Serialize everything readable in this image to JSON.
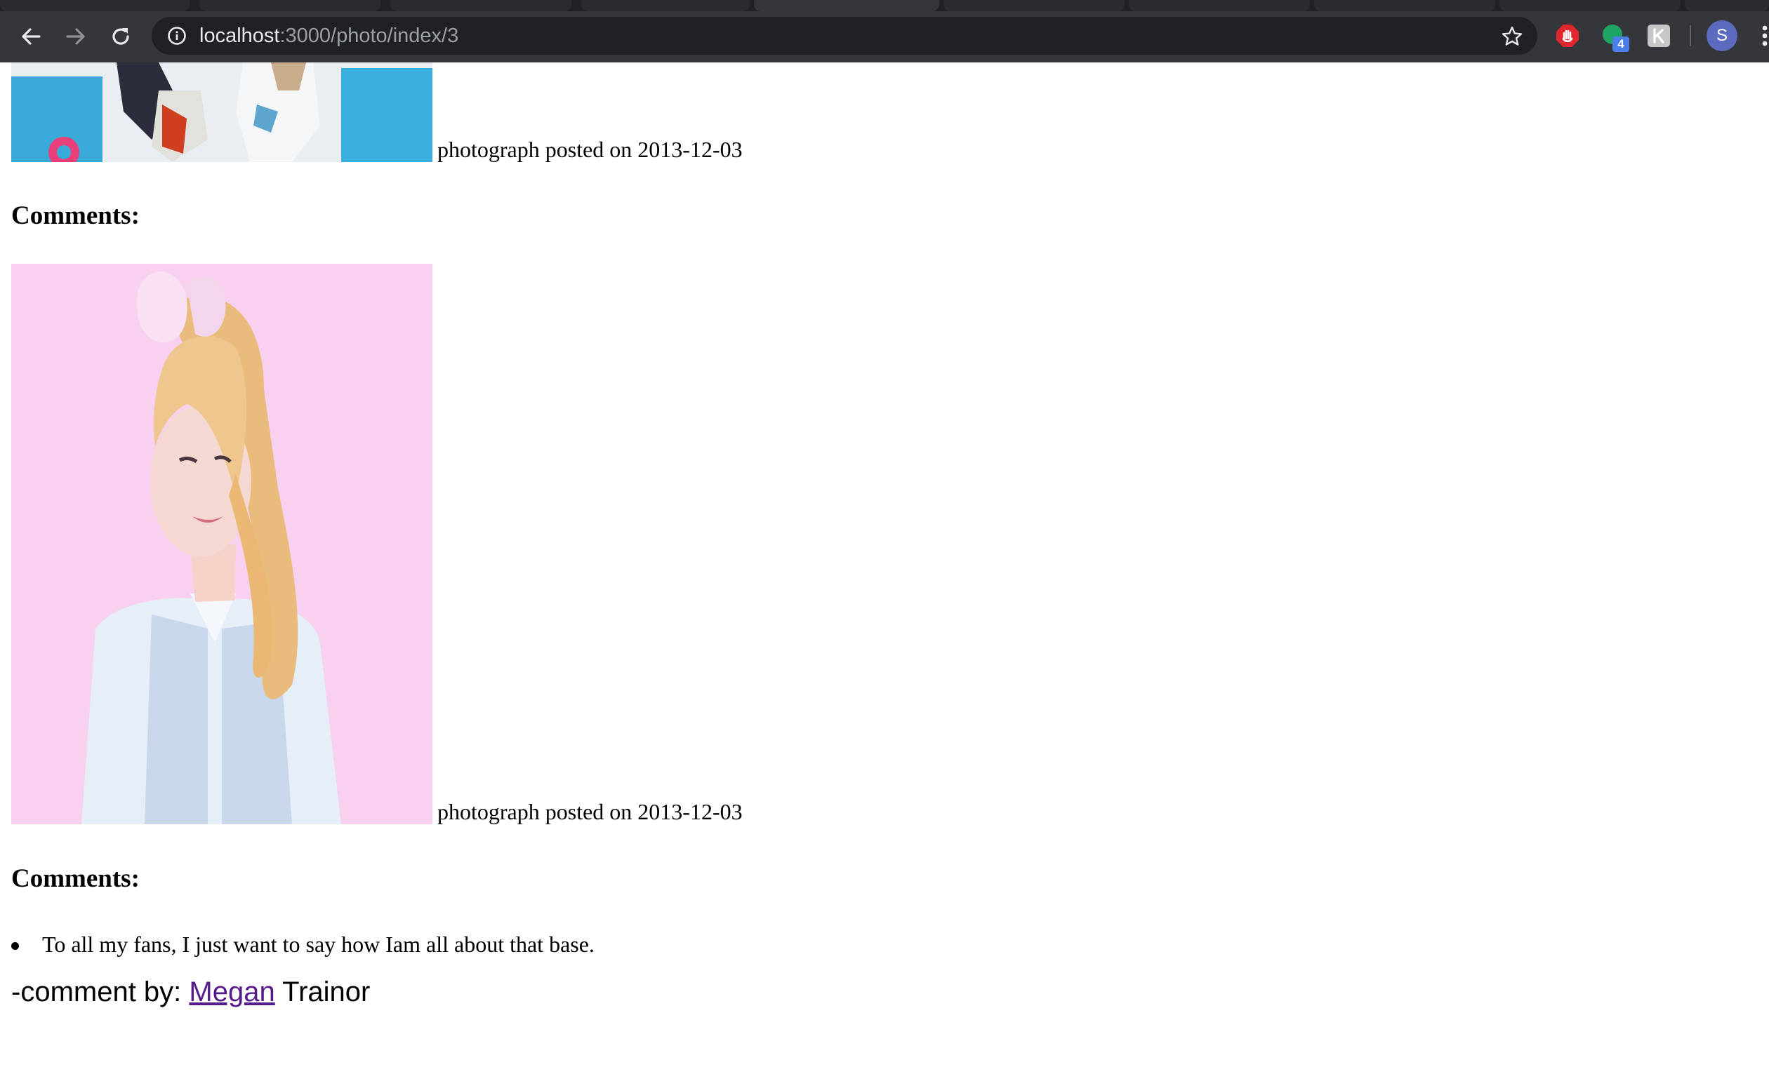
{
  "browser": {
    "url_host": "localhost",
    "url_path": ":3000/photo/index/3",
    "profile_initial": "S",
    "extension_badge": "4",
    "extensions": [
      "adblock-icon",
      "green-dot-extension-icon",
      "k-extension-icon"
    ]
  },
  "posts": [
    {
      "caption": "photograph posted on 2013-12-03",
      "comments_heading": "Comments:",
      "comments": []
    },
    {
      "caption": "photograph posted on 2013-12-03",
      "comments_heading": "Comments:",
      "comments": [
        {
          "text": "To all my fans, I just want to say how Iam all about that base.",
          "by_prefix": "-comment by:",
          "first_name": "Megan",
          "last_name": "Trainor"
        }
      ]
    }
  ],
  "colors": {
    "link": "#551a8b",
    "chrome_bg": "#35363a",
    "omnibox_bg": "#202124",
    "photo2_bg": "#f6c8ec"
  }
}
